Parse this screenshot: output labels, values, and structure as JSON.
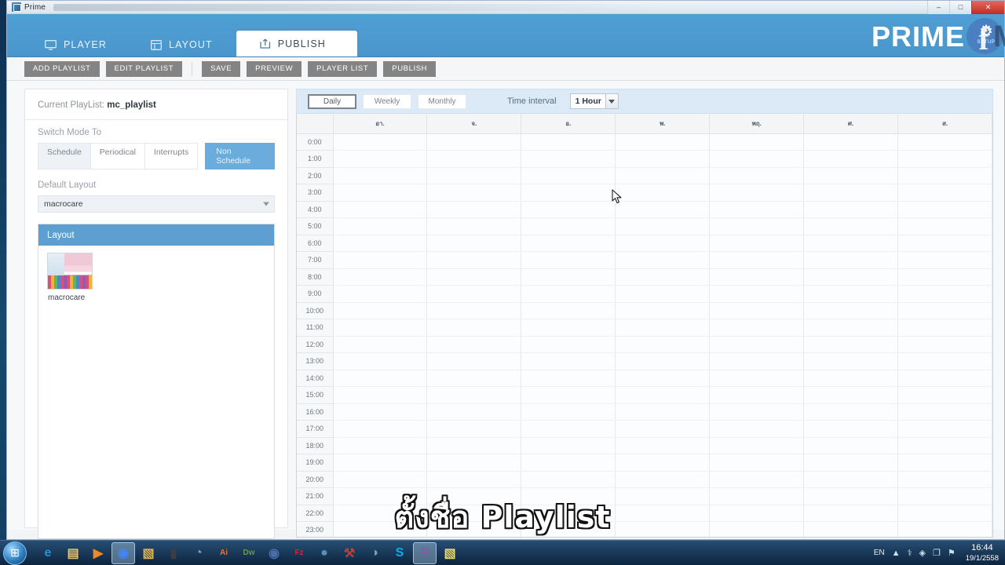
{
  "window": {
    "title": "Prime",
    "minimize_label": "–",
    "maximize_label": "□",
    "close_label": "✕"
  },
  "nav": {
    "tabs": [
      {
        "label": "PLAYER",
        "icon": "monitor-icon",
        "active": false
      },
      {
        "label": "LAYOUT",
        "icon": "grid-icon",
        "active": false
      },
      {
        "label": "PUBLISH",
        "icon": "publish-icon",
        "active": true
      }
    ]
  },
  "brand": {
    "facebook_glyph": "f",
    "watermark": "Macrocare",
    "product_logo": "PRIME",
    "setup_icon": "⚙",
    "setup_label": "SETUP"
  },
  "toolbar": {
    "buttons": [
      "ADD PLAYLIST",
      "EDIT PLAYLIST",
      "SAVE",
      "PREVIEW",
      "PLAYER LIST",
      "PUBLISH"
    ]
  },
  "left_panel": {
    "current_playlist_label": "Current PlayList:",
    "current_playlist_value": "mc_playlist",
    "switch_mode_label": "Switch Mode To",
    "mode_buttons": [
      "Schedule",
      "Periodical",
      "Interrupts"
    ],
    "non_schedule_label": "Non Schedule",
    "default_layout_label": "Default Layout",
    "default_layout_value": "macrocare",
    "layout_box_title": "Layout",
    "layout_items": [
      {
        "label": "macrocare"
      }
    ]
  },
  "schedule": {
    "view_buttons": [
      {
        "label": "Daily",
        "selected": true
      },
      {
        "label": "Weekly",
        "selected": false
      },
      {
        "label": "Monthly",
        "selected": false
      }
    ],
    "time_interval_label": "Time interval",
    "time_interval_value": "1 Hour",
    "day_headers": [
      "อา.",
      "จ.",
      "อ.",
      "พ.",
      "พฤ.",
      "ศ.",
      "ส."
    ],
    "time_rows": [
      "0:00",
      "1:00",
      "2:00",
      "3:00",
      "4:00",
      "5:00",
      "6:00",
      "7:00",
      "8:00",
      "9:00",
      "10:00",
      "11:00",
      "12:00",
      "13:00",
      "14:00",
      "15:00",
      "16:00",
      "17:00",
      "18:00",
      "19:00",
      "20:00",
      "21:00",
      "22:00",
      "23:00"
    ]
  },
  "subtitle": {
    "text": "ตั้งชื่อ Playlist"
  },
  "taskbar": {
    "start_glyph": "⊞",
    "items": [
      {
        "name": "internet-explorer-icon",
        "glyph": "e",
        "color": "#2a8fd8",
        "active": false
      },
      {
        "name": "media-folder-icon",
        "glyph": "▤",
        "color": "#e8c46a",
        "active": false
      },
      {
        "name": "media-player-icon",
        "glyph": "▶",
        "color": "#f08a22",
        "active": false
      },
      {
        "name": "google-chrome-icon",
        "glyph": "◉",
        "color": "#4285f4",
        "active": true
      },
      {
        "name": "file-explorer-icon",
        "glyph": "▧",
        "color": "#e0b44c",
        "active": false
      },
      {
        "name": "computer-icon",
        "glyph": "▮",
        "color": "#3c3c44",
        "active": false
      },
      {
        "name": "thunderbird-icon",
        "glyph": "◔",
        "color": "#6fa8d0",
        "active": false
      },
      {
        "name": "illustrator-icon",
        "glyph": "Ai",
        "color": "#e8762c",
        "active": false
      },
      {
        "name": "dreamweaver-icon",
        "glyph": "Dw",
        "color": "#6a9c3c",
        "active": false
      },
      {
        "name": "nero-icon",
        "glyph": "◉",
        "color": "#4a6fa8",
        "active": false
      },
      {
        "name": "filezilla-icon",
        "glyph": "Fz",
        "color": "#d9232e",
        "active": false
      },
      {
        "name": "utility-icon",
        "glyph": "●",
        "color": "#5a8fb5",
        "active": false
      },
      {
        "name": "tools-icon",
        "glyph": "⚒",
        "color": "#b5453c",
        "active": false
      },
      {
        "name": "paint-icon",
        "glyph": "◑",
        "color": "#7a9ab5",
        "active": false
      },
      {
        "name": "skype-icon",
        "glyph": "S",
        "color": "#00aff0",
        "active": false
      },
      {
        "name": "prime-icon",
        "glyph": "ℙ",
        "color": "#8a56a8",
        "active": true
      },
      {
        "name": "notes-icon",
        "glyph": "▧",
        "color": "#e8d86a",
        "active": false
      }
    ],
    "language": "EN",
    "tray_icons": [
      "▲",
      "⚕",
      "◈",
      "❐",
      "⚑"
    ],
    "clock_time": "16:44",
    "clock_date": "19/1/2558"
  },
  "colors": {
    "header_blue": "#4f9fd4",
    "panel_header_blue": "#5c9fd0",
    "accent_button": "#6aaddc",
    "toolbar_button": "#848484"
  }
}
